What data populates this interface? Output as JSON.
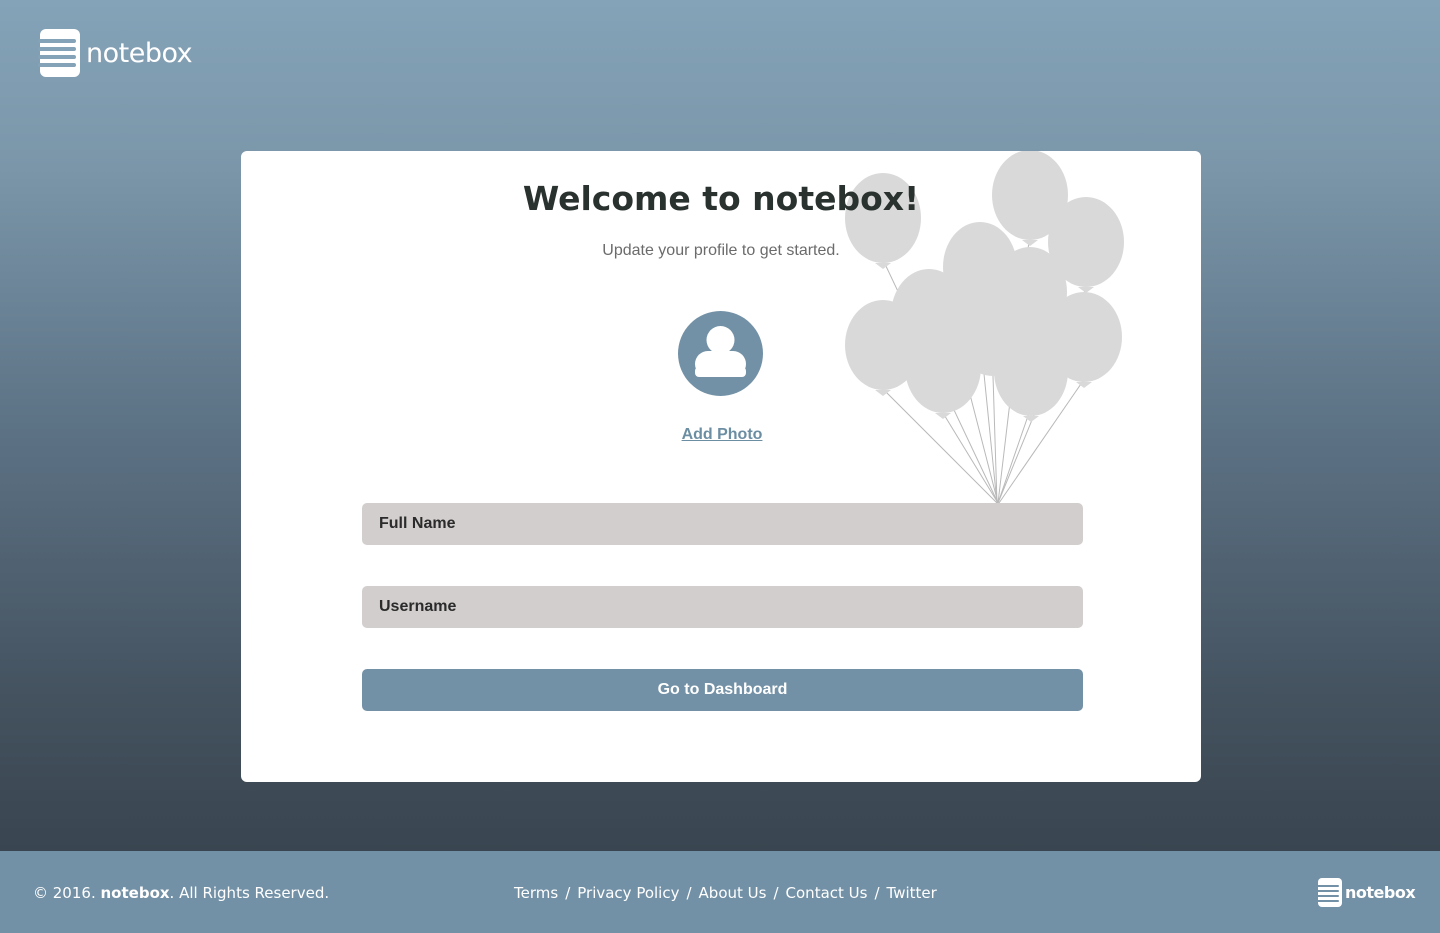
{
  "brand": {
    "name": "notebox"
  },
  "card": {
    "title": "Welcome to notebox!",
    "subtitle": "Update your profile to get started.",
    "add_photo": "Add Photo",
    "full_name_placeholder": "Full Name",
    "username_placeholder": "Username",
    "submit_label": "Go to Dashboard"
  },
  "footer": {
    "copyright_prefix": "© 2016.",
    "copyright_brand": "notebox",
    "copyright_suffix": ". All Rights Reserved.",
    "links": [
      "Terms",
      "Privacy Policy",
      "About Us",
      "Contact Us",
      "Twitter"
    ],
    "separator": "/",
    "brand_name": "notebox"
  },
  "colors": {
    "accent": "#7391a6",
    "input_bg": "#d3cece",
    "balloon": "#d9d9d9",
    "title": "#2a3230"
  }
}
